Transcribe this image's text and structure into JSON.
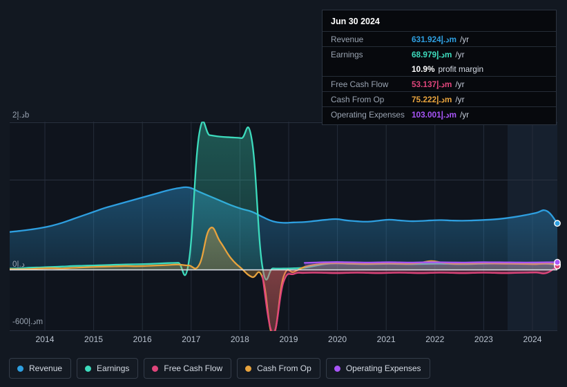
{
  "tooltip": {
    "date": "Jun 30 2024",
    "rows": [
      {
        "key": "Revenue",
        "value": "631.924د.إm",
        "unit": "/yr",
        "color": "#2e9fe0"
      },
      {
        "key": "Earnings",
        "value": "68.979د.إm",
        "unit": "/yr",
        "color": "#3ddbbd"
      },
      {
        "key": "",
        "value": "10.9%",
        "unit": "profit margin",
        "color": "#ffffff",
        "sub": true
      },
      {
        "key": "Free Cash Flow",
        "value": "53.137د.إm",
        "unit": "/yr",
        "color": "#e0457b"
      },
      {
        "key": "Cash From Op",
        "value": "75.222د.إm",
        "unit": "/yr",
        "color": "#e8a33d"
      },
      {
        "key": "Operating Expenses",
        "value": "103.001د.إm",
        "unit": "/yr",
        "color": "#a855f7"
      }
    ]
  },
  "legend": {
    "items": [
      {
        "label": "Revenue",
        "color": "#2e9fe0"
      },
      {
        "label": "Earnings",
        "color": "#3ddbbd"
      },
      {
        "label": "Free Cash Flow",
        "color": "#e0457b"
      },
      {
        "label": "Cash From Op",
        "color": "#e8a33d"
      },
      {
        "label": "Operating Expenses",
        "color": "#a855f7"
      }
    ]
  },
  "chart_data": {
    "type": "area",
    "title": "",
    "xlabel": "",
    "ylabel": "",
    "currency": "د.إ",
    "ylim": [
      -600000000,
      2000000000
    ],
    "grid": true,
    "legend_position": "bottom",
    "y_ticks": [
      {
        "value": 2000000000,
        "label": "2د.إb"
      },
      {
        "value": 700000000,
        "label": ""
      },
      {
        "value": 0,
        "label": "0د.إ"
      },
      {
        "value": -600000000,
        "label": "-600د.إm"
      }
    ],
    "x_ticks": [
      "2014",
      "2015",
      "2016",
      "2017",
      "2018",
      "2019",
      "2020",
      "2021",
      "2022",
      "2023",
      "2024"
    ],
    "x_range": [
      "2013-06-30",
      "2024-06-30"
    ],
    "highlight_band": {
      "from": "2023-07",
      "to": "2024-06-30",
      "label": ""
    },
    "endpoints": [
      {
        "series": "Revenue",
        "value": 631924000
      },
      {
        "series": "Operating Expenses",
        "value": 103001000
      },
      {
        "series": "Cash From Op",
        "value": 75222000
      },
      {
        "series": "Earnings",
        "value": 68979000
      },
      {
        "series": "Free Cash Flow",
        "value": 53137000
      }
    ],
    "series": [
      {
        "name": "Revenue",
        "color": "#2e9fe0",
        "values": [
          515,
          530,
          548,
          570,
          600,
          640,
          690,
          740,
          790,
          840,
          880,
          920,
          960,
          1000,
          1040,
          1080,
          1110,
          1120,
          1060,
          1000,
          940,
          880,
          830,
          790,
          720,
          660,
          640,
          645,
          650,
          665,
          680,
          690,
          672,
          660,
          655,
          668,
          682,
          672,
          662,
          664,
          672,
          676,
          670,
          668,
          672,
          678,
          686,
          700,
          720,
          745,
          775,
          800,
          632
        ]
      },
      {
        "name": "Earnings",
        "color": "#3ddbbd",
        "values": [
          18,
          22,
          30,
          34,
          40,
          45,
          52,
          56,
          60,
          64,
          70,
          74,
          76,
          80,
          86,
          92,
          96,
          100,
          1850,
          1830,
          1810,
          1800,
          1790,
          1760,
          40,
          20,
          18,
          22,
          30,
          55,
          80,
          88,
          84,
          80,
          78,
          80,
          82,
          80,
          78,
          80,
          82,
          84,
          80,
          78,
          80,
          84,
          86,
          88,
          88,
          86,
          84,
          82,
          69
        ]
      },
      {
        "name": "Free Cash Flow",
        "color": "#e0457b",
        "values": [
          null,
          null,
          null,
          null,
          null,
          null,
          null,
          null,
          null,
          null,
          null,
          null,
          null,
          null,
          null,
          null,
          null,
          null,
          null,
          null,
          null,
          null,
          null,
          null,
          -60,
          -620,
          -120,
          -40,
          -30,
          -28,
          -30,
          -32,
          -30,
          -28,
          -30,
          -32,
          -30,
          -28,
          -30,
          -32,
          -30,
          -28,
          -30,
          -32,
          -30,
          -28,
          -30,
          -32,
          -30,
          -28,
          -26,
          -30,
          53
        ]
      },
      {
        "name": "Cash From Op",
        "color": "#e8a33d",
        "values": [
          10,
          8,
          12,
          20,
          24,
          20,
          28,
          34,
          40,
          44,
          48,
          52,
          50,
          54,
          60,
          66,
          72,
          60,
          70,
          560,
          380,
          160,
          20,
          -70,
          -75,
          -640,
          -70,
          -20,
          40,
          70,
          86,
          90,
          86,
          82,
          80,
          84,
          86,
          84,
          82,
          96,
          120,
          100,
          84,
          82,
          84,
          88,
          86,
          84,
          82,
          80,
          78,
          86,
          75
        ]
      },
      {
        "name": "Operating Expenses",
        "color": "#a855f7",
        "values": [
          null,
          null,
          null,
          null,
          null,
          null,
          null,
          null,
          null,
          null,
          null,
          null,
          null,
          null,
          null,
          null,
          null,
          null,
          null,
          null,
          null,
          null,
          null,
          null,
          null,
          null,
          null,
          null,
          95,
          100,
          104,
          106,
          104,
          102,
          100,
          102,
          104,
          102,
          100,
          102,
          104,
          103,
          101,
          100,
          102,
          104,
          103,
          102,
          101,
          100,
          101,
          103,
          103
        ]
      }
    ]
  }
}
